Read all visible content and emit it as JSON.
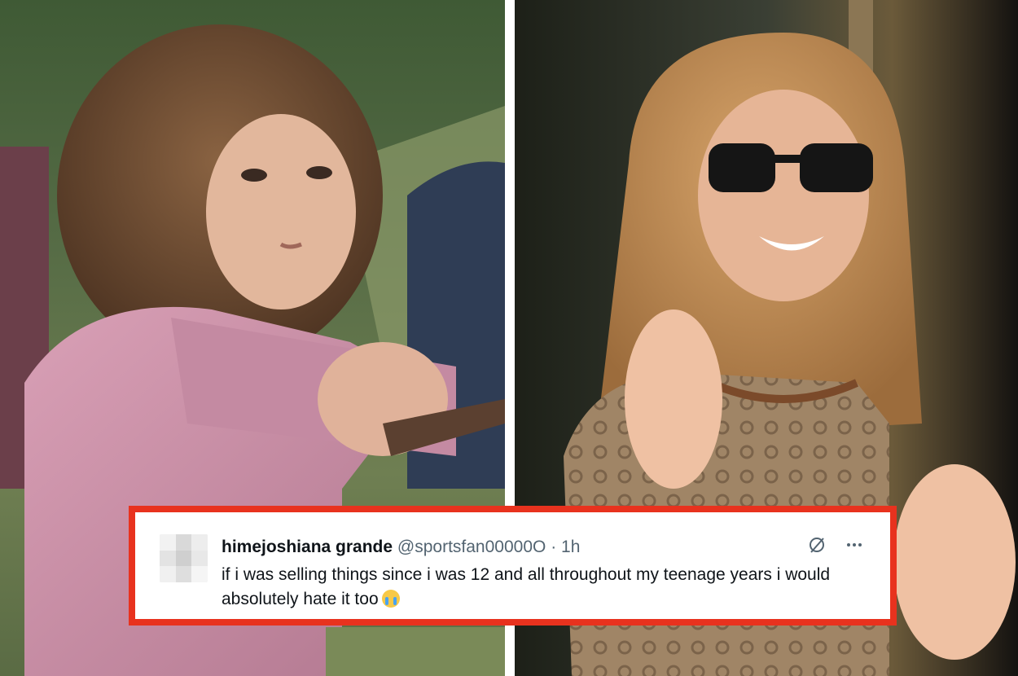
{
  "tweet": {
    "display_name": "himejoshiana grande",
    "handle": "@sportsfan00000O",
    "separator": "·",
    "timestamp": "1h",
    "text": "if i was selling things since i was 12 and all throughout my teenage years i would absolutely hate it too",
    "emoji": "loudly-crying-face-icon"
  },
  "photos": {
    "left": "young-actress-holding-wand-photo",
    "right": "adult-actress-waving-sunglasses-photo"
  },
  "colors": {
    "frame_border": "#e8321e",
    "name_text": "#0f1419",
    "meta_text": "#536471"
  }
}
